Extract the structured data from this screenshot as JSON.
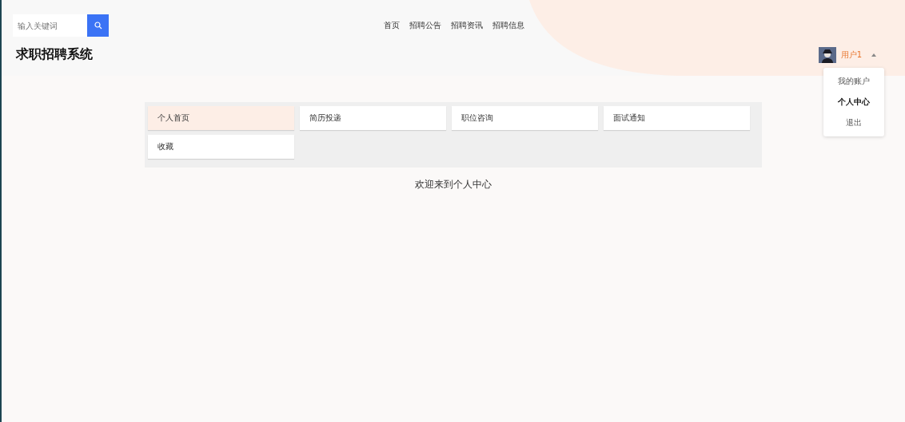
{
  "search": {
    "placeholder": "输入关键词"
  },
  "nav": [
    {
      "label": "首页"
    },
    {
      "label": "招聘公告"
    },
    {
      "label": "招聘资讯"
    },
    {
      "label": "招聘信息"
    }
  ],
  "site_title": "求职招聘系统",
  "user": {
    "name": "用户1",
    "menu_expanded": true,
    "menu": [
      {
        "label": "我的账户",
        "selected": false
      },
      {
        "label": "个人中心",
        "selected": true
      },
      {
        "label": "退出",
        "selected": false
      }
    ]
  },
  "tiles": [
    {
      "label": "个人首页",
      "selected": true
    },
    {
      "label": "简历投递",
      "selected": false
    },
    {
      "label": "职位咨询",
      "selected": false
    },
    {
      "label": "面试通知",
      "selected": false
    },
    {
      "label": "收藏",
      "selected": false
    }
  ],
  "welcome": "欢迎来到个人中心"
}
